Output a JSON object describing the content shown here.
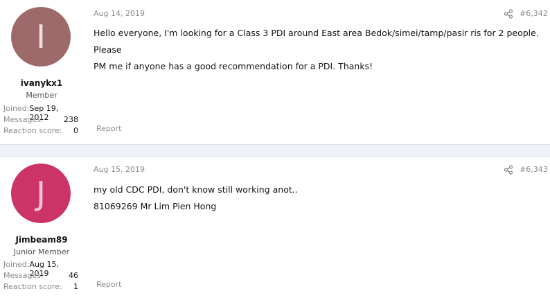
{
  "posts": [
    {
      "avatar_letter": "I",
      "avatar_bg": "#9e6a69",
      "avatar_fg": "#f1dede",
      "username": "ivanykx1",
      "user_title": "Member",
      "stats": [
        {
          "label": "Joined:",
          "value": "Sep 19, 2012"
        },
        {
          "label": "Messages:",
          "value": "238"
        },
        {
          "label": "Reaction score:",
          "value": "0"
        }
      ],
      "date": "Aug 14, 2019",
      "post_number": "#6,342",
      "lines": [
        "Hello everyone, I'm looking for a Class 3 PDI around East area Bedok/simei/tamp/pasir ris for 2 people. Please",
        "PM me if anyone has a good recommendation for a PDI. Thanks!"
      ],
      "report_label": "Report",
      "share_icon": "share-icon"
    },
    {
      "avatar_letter": "J",
      "avatar_bg": "#cc3366",
      "avatar_fg": "#f6c6d4",
      "username": "Jimbeam89",
      "user_title": "Junior Member",
      "stats": [
        {
          "label": "Joined:",
          "value": "Aug 15, 2019"
        },
        {
          "label": "Messages:",
          "value": "46"
        },
        {
          "label": "Reaction score:",
          "value": "1"
        }
      ],
      "date": "Aug 15, 2019",
      "post_number": "#6,343",
      "lines": [
        "my old CDC PDI, don't know still working anot..",
        "81069269 Mr Lim Pien Hong"
      ],
      "report_label": "Report",
      "share_icon": "share-icon"
    }
  ]
}
